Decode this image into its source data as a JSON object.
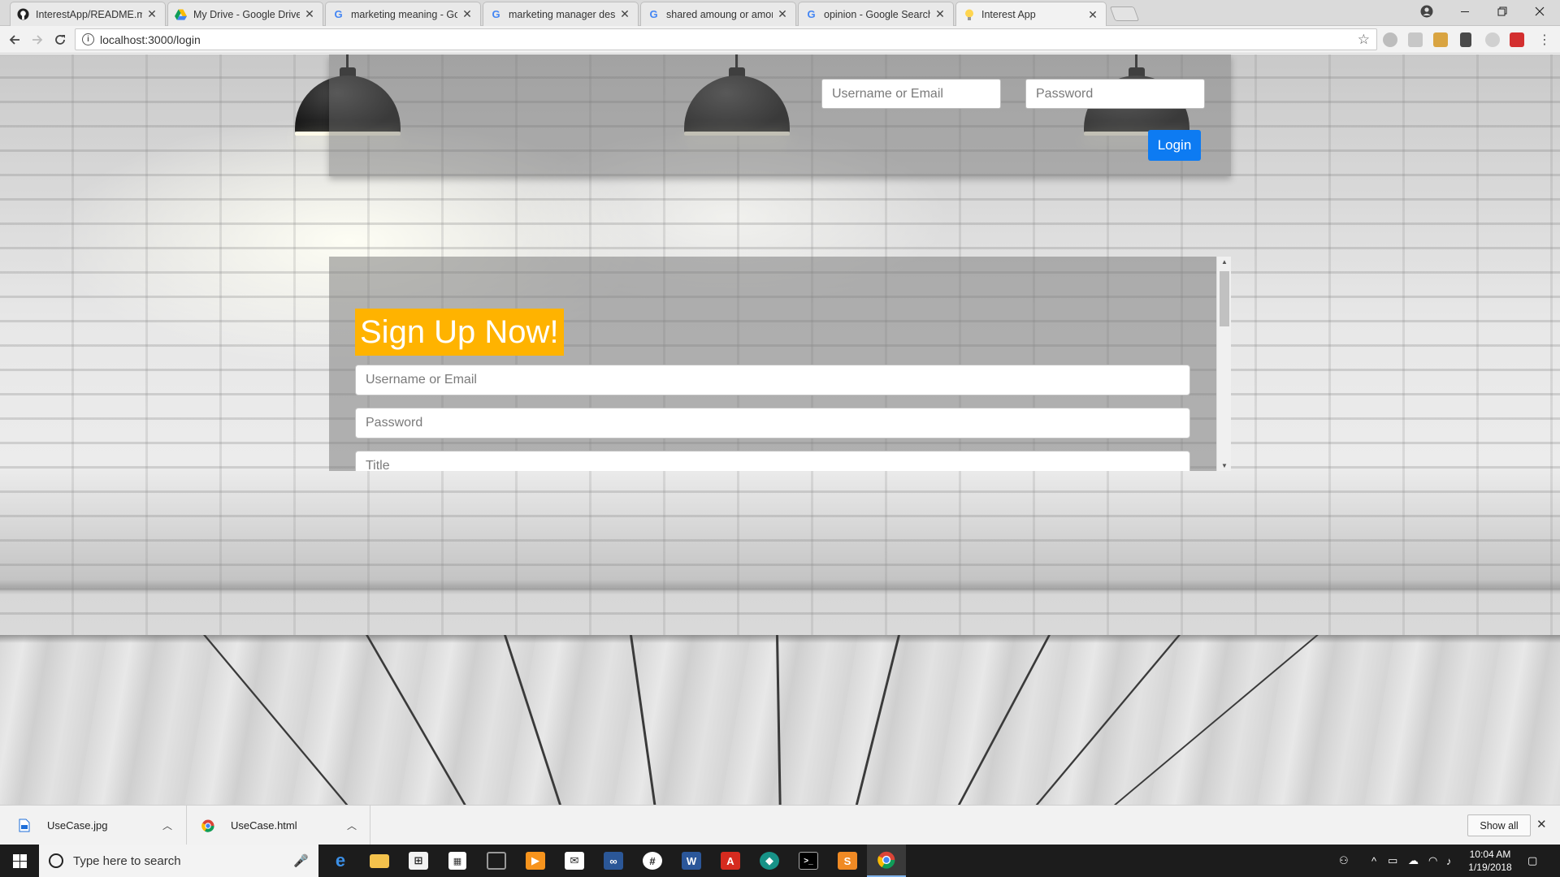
{
  "browser": {
    "tabs": [
      {
        "title": "InterestApp/README.md",
        "favicon": "github-icon"
      },
      {
        "title": "My Drive - Google Drive",
        "favicon": "google-drive-icon"
      },
      {
        "title": "marketing meaning - Go",
        "favicon": "google-icon"
      },
      {
        "title": "marketing manager desc",
        "favicon": "google-icon"
      },
      {
        "title": "shared amoung or amon",
        "favicon": "google-icon"
      },
      {
        "title": "opinion - Google Search",
        "favicon": "google-icon"
      },
      {
        "title": "Interest App",
        "favicon": "lightbulb-icon",
        "active": true
      }
    ],
    "close_glyph": "✕",
    "url": "localhost:3000/login"
  },
  "page": {
    "header": {
      "username_placeholder": "Username or Email",
      "password_placeholder": "Password",
      "login_label": "Login"
    },
    "signup": {
      "title": "Sign Up Now!",
      "username_placeholder": "Username or Email",
      "password_placeholder": "Password",
      "title_placeholder": "Title"
    },
    "colors": {
      "login_button": "#0d7bf2",
      "signup_title_bg": "#ffb300"
    }
  },
  "downloads": {
    "items": [
      {
        "name": "UseCase.jpg",
        "icon": "image-file-icon"
      },
      {
        "name": "UseCase.html",
        "icon": "chrome-icon"
      }
    ],
    "show_all_label": "Show all"
  },
  "taskbar": {
    "search_placeholder": "Type here to search",
    "apps": [
      "edge-icon",
      "file-explorer-icon",
      "store-icon",
      "task-view-icon",
      "app-icon",
      "media-player-icon",
      "mail-icon",
      "visual-studio-icon",
      "slack-icon",
      "word-icon",
      "acrobat-icon",
      "gitkraken-icon",
      "terminal-icon",
      "sublime-text-icon",
      "chrome-icon"
    ],
    "time": "10:04 AM",
    "date": "1/19/2018"
  }
}
